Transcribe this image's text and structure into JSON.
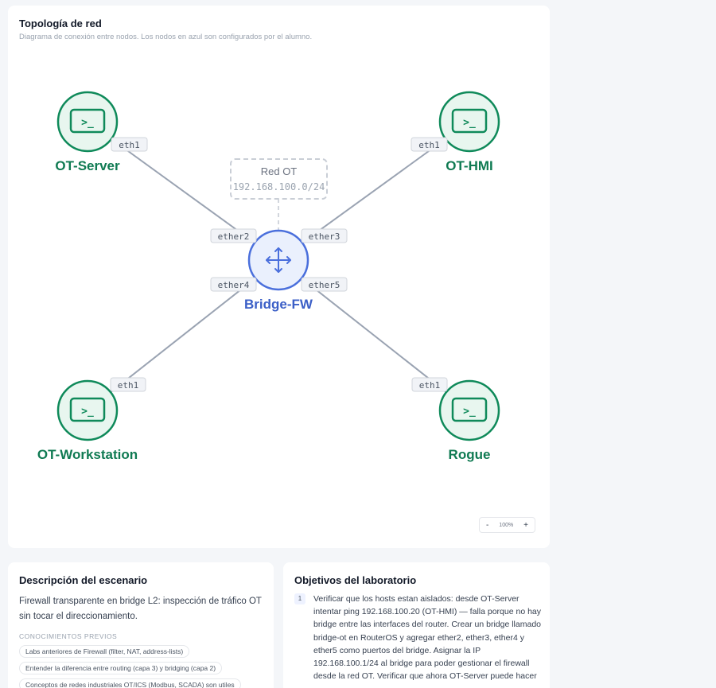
{
  "topology": {
    "title": "Topología de red",
    "subtitle": "Diagrama de conexión entre nodos. Los nodos en azul son configurados por el alumno.",
    "network": {
      "name": "Red OT",
      "cidr": "192.168.100.0/24"
    },
    "nodes": [
      {
        "id": "ot-server",
        "label": "OT-Server",
        "iface": "eth1",
        "icon": "terminal-icon"
      },
      {
        "id": "ot-hmi",
        "label": "OT-HMI",
        "iface": "eth1",
        "icon": "terminal-icon"
      },
      {
        "id": "ot-workstation",
        "label": "OT-Workstation",
        "iface": "eth1",
        "icon": "terminal-icon"
      },
      {
        "id": "rogue",
        "label": "Rogue",
        "iface": "eth1",
        "icon": "terminal-icon"
      }
    ],
    "bridge": {
      "label": "Bridge-FW",
      "icon": "move-arrows-icon",
      "ports": [
        "ether2",
        "ether3",
        "ether4",
        "ether5"
      ]
    },
    "zoom": {
      "minus": "-",
      "level": "100%",
      "plus": "+"
    },
    "colors": {
      "host": "#0f8a5a",
      "host_fill": "#e8f6ef",
      "bridge": "#4a6fdc",
      "bridge_fill": "#eaf0fd",
      "link": "#9aa3b2"
    }
  },
  "description": {
    "title": "Descripción del escenario",
    "text": "Firewall transparente en bridge L2: inspección de tráfico OT sin tocar el direccionamiento.",
    "prereq_heading": "CONOCIMIENTOS PREVIOS",
    "prereqs": [
      "Labs anteriores de Firewall (filter, NAT, address-lists)",
      "Entender la diferencia entre routing (capa 3) y bridging (capa 2)",
      "Conceptos de redes industriales OT/ICS (Modbus, SCADA) son utiles"
    ]
  },
  "objectives": {
    "title": "Objetivos del laboratorio",
    "items": [
      {
        "num": "1",
        "text": "Verificar que los hosts estan aislados: desde OT-Server intentar ping 192.168.100.20 (OT-HMI) — falla porque no hay bridge entre las interfaces del router. Crear un bridge llamado bridge-ot en RouterOS y agregar ether2, ether3, ether4 y ether5 como puertos del bridge. Asignar la IP 192.168.100.1/24 al bridge para poder gestionar el firewall desde la red OT. Verificar que ahora OT-Server puede hacer"
      }
    ]
  }
}
